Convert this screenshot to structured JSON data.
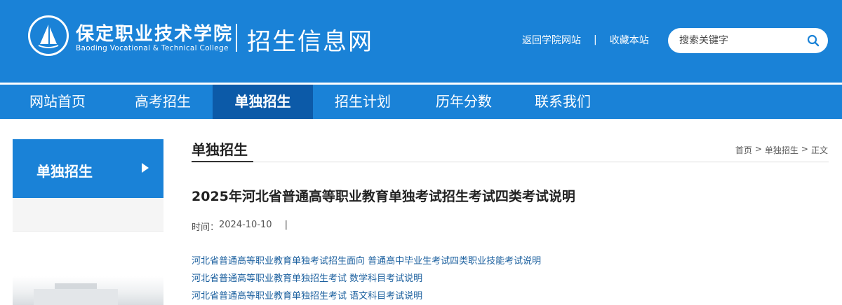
{
  "header": {
    "school_name_cn": "保定职业技术学院",
    "school_name_en": "Baoding Vocational & Technical College",
    "site_title": "招生信息网",
    "links": [
      "返回学院网站",
      "收藏本站"
    ],
    "link_separator": "|",
    "search": {
      "placeholder": "搜索关键字",
      "icon": "search-icon"
    },
    "logo_icon": "sailboat-logo-icon"
  },
  "nav": {
    "items": [
      "网站首页",
      "高考招生",
      "单独招生",
      "招生计划",
      "历年分数",
      "联系我们"
    ],
    "active_index": 2
  },
  "sidebar": {
    "active_item": "单独招生",
    "arrow_icon": "triangle-right-icon"
  },
  "main": {
    "section_title": "单独招生",
    "breadcrumb": [
      "首页",
      ">",
      "单独招生",
      ">",
      "正文"
    ],
    "article": {
      "title": "2025年河北省普通高等职业教育单独考试招生考试四类考试说明",
      "time_label": "时间：",
      "time_value": "2024-10-10",
      "time_sep": "|"
    },
    "links": [
      "河北省普通高等职业教育单独考试招生面向 普通高中毕业生考试四类职业技能考试说明",
      "河北省普通高等职业教育单独招生考试 数学科目考试说明",
      "河北省普通高等职业教育单独招生考试 语文科目考试说明"
    ]
  },
  "colors": {
    "primary": "#1a82d7",
    "nav_active": "#0c5aa8",
    "link": "#1a5f9e"
  }
}
